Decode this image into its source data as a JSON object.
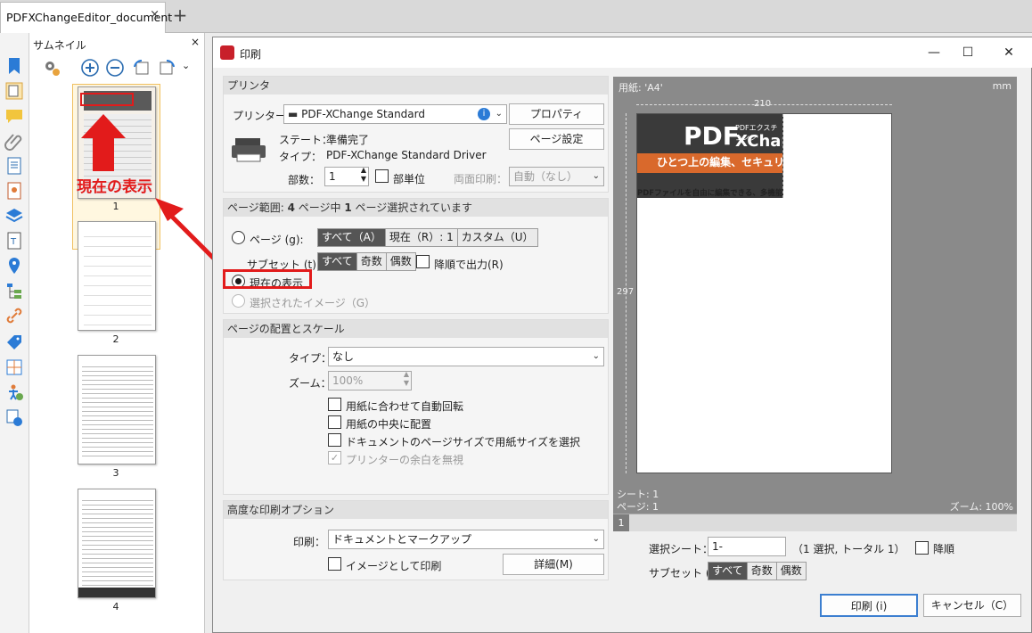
{
  "tab": {
    "title": "PDFXChangeEditor_document",
    "close": "×",
    "new": "+"
  },
  "thumbnails": {
    "title": "サムネイル",
    "close": "×",
    "pages": [
      "1",
      "2",
      "3",
      "4"
    ],
    "annotation": "現在の表示"
  },
  "dialog": {
    "title": "印刷",
    "printer": {
      "header": "プリンタ",
      "printer_label": "プリンター...",
      "printer_value": "PDF-XChange Standard",
      "properties_button": "プロパティ",
      "page_setup_button": "ページ設定",
      "state_label": "ステート：",
      "state_value": "準備完了",
      "type_label": "タイプ：",
      "type_value": "PDF-XChange Standard Driver",
      "copies_label": "部数：",
      "copies_value": "1",
      "collate_label": "部単位",
      "duplex_label": "両面印刷：",
      "duplex_value": "自動（なし）"
    },
    "range": {
      "header_prefix": "ページ範囲: ",
      "header_count": "4",
      "header_mid": " ページ中 ",
      "header_sel": "1",
      "header_suffix": " ページ選択されています",
      "pages_label": "ページ (g):",
      "pages_all": "すべて（A）",
      "pages_current": "現在（R）: 1",
      "pages_custom": "カスタム（U）",
      "subset_label": "サブセット (t):",
      "subset_all": "すべて",
      "subset_odd": "奇数",
      "subset_even": "偶数",
      "reverse_label": "降順で出力(R)",
      "current_view_label": "現在の表示",
      "selected_image_label": "選択されたイメージ（G）"
    },
    "placement": {
      "header": "ページの配置とスケール",
      "type_label": "タイプ：",
      "type_value": "なし",
      "zoom_label": "ズーム：",
      "zoom_value": "100%",
      "auto_rotate": "用紙に合わせて自動回転",
      "center": "用紙の中央に配置",
      "doc_size": "ドキュメントのページサイズで用紙サイズを選択",
      "ignore_margins": "プリンターの余白を無視"
    },
    "advanced": {
      "header": "高度な印刷オプション",
      "print_label": "印刷：",
      "print_value": "ドキュメントとマークアップ",
      "as_image": "イメージとして印刷",
      "details_button": "詳細(M)"
    },
    "preview": {
      "paper_label": "用紙: 'A4'",
      "unit": "mm",
      "width": "210",
      "height": "297",
      "banner_pdf": "PDF",
      "banner_kana": "PDFエクスチェンジ",
      "banner_x": "XChange",
      "banner_sub": "ひとつ上の編集、セキュリティ",
      "banner_desc": "PDFファイルを自由に編集できる、多機能",
      "sheet": "シート: 1",
      "page": "ページ: 1",
      "zoom": "ズーム: 100%",
      "scroll_page": "1"
    },
    "sheets": {
      "selected_label": "選択シート：",
      "selected_value": "1-",
      "info": "（1 選択, トータル 1）",
      "reverse_label": "降順",
      "subset_label": "サブセット (t):",
      "subset_all": "すべて",
      "subset_odd": "奇数",
      "subset_even": "偶数"
    },
    "print_button": "印刷 (i)",
    "cancel_button": "キャンセル（C）"
  },
  "colors": {
    "accent_red": "#e21b1b",
    "segment_active": "#555555"
  }
}
